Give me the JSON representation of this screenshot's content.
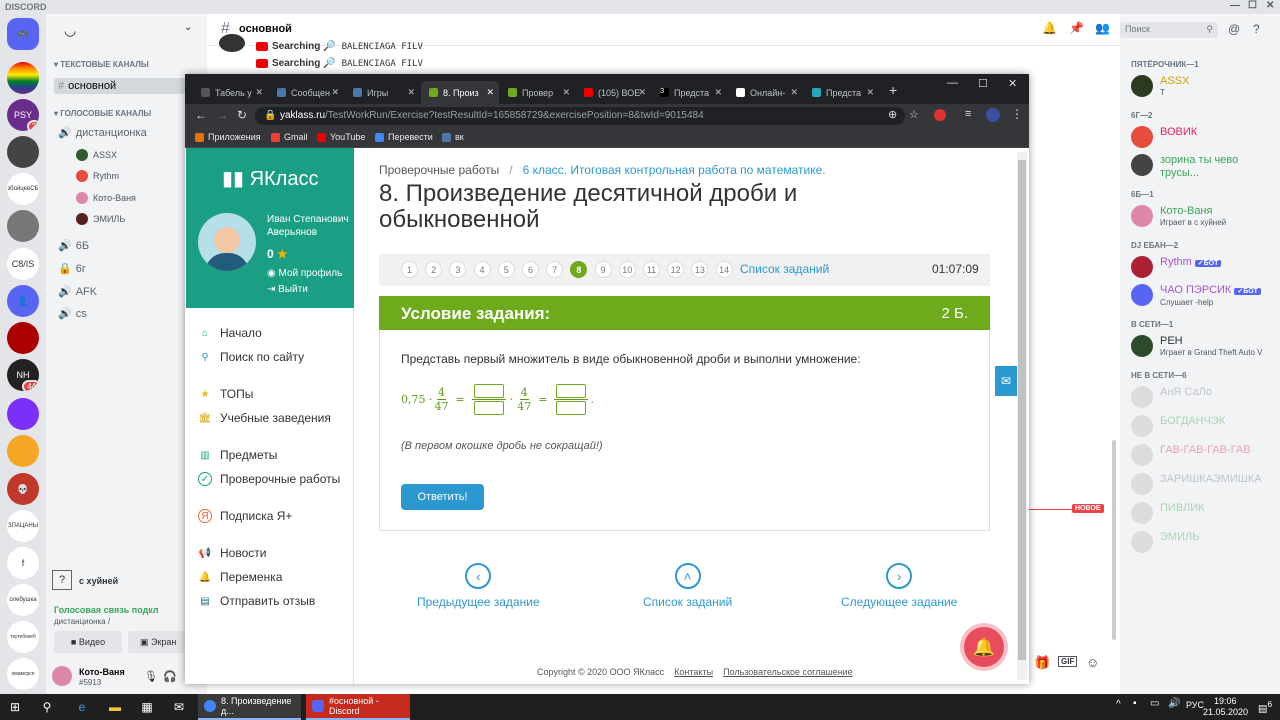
{
  "discord": {
    "title": "DISCORD",
    "channel_header": "основной",
    "search_placeholder": "Поиск",
    "text_channels_cat": "ТЕКСТОВЫЕ КАНАЛЫ",
    "voice_channels_cat": "ГОЛОСОВЫЕ КАНАЛЫ",
    "text_channels": [
      "основной"
    ],
    "voice_channel": "дистанционка",
    "voice_users": [
      "ASSX",
      "Rythm",
      "Кото-Ваня",
      "ЭМИЛЬ"
    ],
    "other_channels": [
      "6Б",
      "6г",
      "AFK",
      "cs"
    ],
    "messages": [
      {
        "author": "Searching 🔎",
        "text": "BALENCIAGA FILV"
      },
      {
        "author": "Searching 🔎",
        "text": "BALENCIAGA FILV"
      }
    ],
    "new_badge": "НОВОЕ",
    "status_text": "с хуйней",
    "voice_connected": "Голосовая связь подкл",
    "voice_connected_sub": "дистанционка / ",
    "video_btn": "Видео",
    "screen_btn": "Экран",
    "user_name": "Кото-Ваня",
    "user_tag": "#5913",
    "guild_badges": [
      "2",
      "44"
    ],
    "guild_labels": [
      "C8/IS",
      "f",
      "збойцевСБ",
      "олебушка",
      "ткутебекеб",
      "омамсрсп"
    ],
    "members": [
      {
        "cat": "ПЯТЁРОЧНИК—1",
        "items": [
          {
            "name": "ASSX",
            "status": "Т",
            "color": "#c9a300"
          }
        ]
      },
      {
        "cat": "6Г—2",
        "items": [
          {
            "name": "ВОВИК",
            "status": "",
            "color": "#e0245e"
          },
          {
            "name": "зорина ты чево трусы...",
            "status": "",
            "color": "#3ba55c"
          }
        ]
      },
      {
        "cat": "6Б—1",
        "items": [
          {
            "name": "Кото-Ваня",
            "status": "Играет в с хуйней",
            "color": "#3ba55c"
          }
        ]
      },
      {
        "cat": "DJ ЕБАН—2",
        "items": [
          {
            "name": "Rythm",
            "status": "",
            "color": "#a855c9",
            "bot": "✓БОТ"
          },
          {
            "name": "ЧАО ПЭРСИК",
            "status": "Слушает -help",
            "color": "#a855c9",
            "bot": "✓БОТ"
          }
        ]
      },
      {
        "cat": "В СЕТИ—1",
        "items": [
          {
            "name": "РЕН",
            "status": "Играет в Grand Theft Auto V",
            "color": "#2e3338"
          }
        ]
      },
      {
        "cat": "НЕ В СЕТИ—6",
        "items": [
          {
            "name": "АнЯ СаЛо",
            "status": "",
            "color": "#747f8d"
          },
          {
            "name": "БОГДАНЧЭК",
            "status": "",
            "color": "#3ba55c"
          },
          {
            "name": "ГАВ-ГАВ-ГАВ-ГАВ",
            "status": "",
            "color": "#e0245e"
          },
          {
            "name": "ЗАРИШКАЭМИШКА",
            "status": "",
            "color": "#747f8d"
          },
          {
            "name": "ПИВЛИК",
            "status": "",
            "color": "#3ba55c"
          },
          {
            "name": "ЭМИЛЬ",
            "status": "",
            "color": "#3ba55c"
          }
        ]
      }
    ]
  },
  "browser": {
    "tabs": [
      "Табель у",
      "Сообщен",
      "Игры",
      "8. Произ",
      "Провер",
      "(105) ВОЕ",
      "Предста",
      "Онлайн-",
      "Предста"
    ],
    "url_host": "yaklass.ru",
    "url_path": "/TestWorkRun/Exercise?testResultId=165858729&exercisePosition=8&twId=9015484",
    "bookmarks": [
      "Приложения",
      "Gmail",
      "YouTube",
      "Перевести",
      "вк"
    ]
  },
  "yaklass": {
    "logo": "ЯКласс",
    "user_name": "Иван Степанович Аверьянов",
    "score": "0",
    "profile_link": "Мой профиль",
    "logout_link": "Выйти",
    "nav": [
      "Начало",
      "Поиск по сайту",
      "ТОПы",
      "Учебные заведения",
      "Предметы",
      "Проверочные работы",
      "Подписка Я+",
      "Новости",
      "Переменка",
      "Отправить отзыв"
    ],
    "breadcrumb_1": "Проверочные работы",
    "breadcrumb_2": "6 класс. Итоговая контрольная работа по математике.",
    "title": "8. Произведение десятичной дроби и обыкновенной",
    "pages": [
      "1",
      "2",
      "3",
      "4",
      "5",
      "6",
      "7",
      "8",
      "9",
      "10",
      "11",
      "12",
      "13",
      "14"
    ],
    "current_page": "8",
    "task_list_link": "Список заданий",
    "timer": "01:07:09",
    "condition_title": "Условие задания:",
    "points": "2 Б.",
    "instruction": "Представь первый множитель в виде обыкновенной дроби и выполни умножение:",
    "expr_lead": "0,75 ·",
    "num": "4",
    "den": "47",
    "note": "(В первом окошке дробь не сокращай!)",
    "answer_btn": "Ответить!",
    "prev_task": "Предыдущее задание",
    "list_task": "Список заданий",
    "next_task": "Следующее задание",
    "footer_copy": "Copyright © 2020 ООО ЯКласс",
    "footer_contacts": "Контакты",
    "footer_terms": "Пользовательское соглашение"
  },
  "taskbar": {
    "apps": [
      "8. Произведение д...",
      "#основной - Discord"
    ],
    "lang": "РУС",
    "time": "19:06",
    "date": "21.05.2020",
    "notif_count": "6"
  }
}
